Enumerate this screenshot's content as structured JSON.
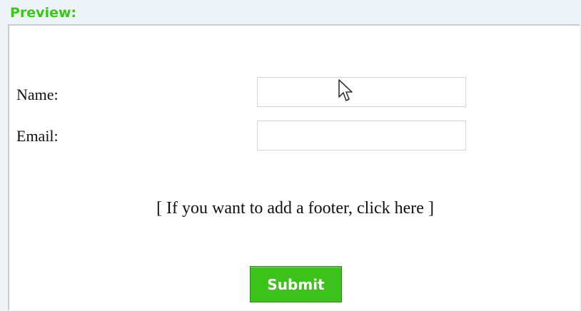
{
  "preview": {
    "title": "Preview:"
  },
  "form": {
    "name_label": "Name:",
    "email_label": "Email:",
    "name_value": "",
    "email_value": "",
    "footer_prompt": "[ If you want to add a footer, click here ]",
    "submit_label": "Submit"
  },
  "colors": {
    "title_green": "#33cc11",
    "submit_green": "#3cc21a",
    "frame_border": "#c8cdd3"
  },
  "icons": {
    "cursor": "mouse-pointer-arrow"
  }
}
